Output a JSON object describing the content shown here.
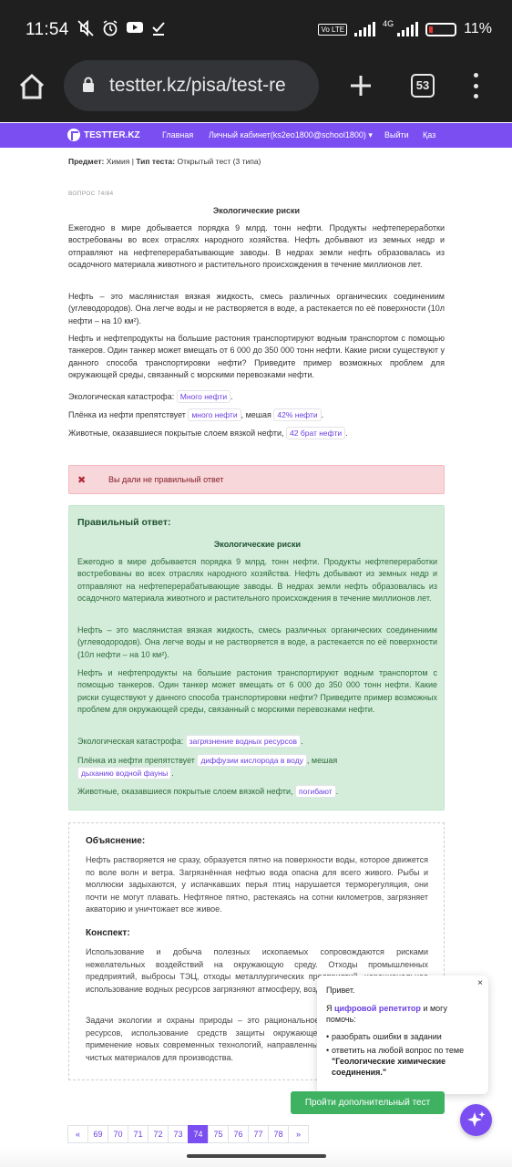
{
  "status_bar": {
    "time": "11:54",
    "network": "4G",
    "volte": "Vo LTE",
    "battery": "11%"
  },
  "browser": {
    "url": "testter.kz/pisa/test-re",
    "tab_count": "53"
  },
  "site_nav": {
    "logo": "TESTTER.KZ",
    "items": [
      "Главная",
      "Личный кабинет(ks2eo1800@school1800) ▾",
      "Выйти",
      "Қаз"
    ]
  },
  "meta": {
    "subject_label": "Предмет:",
    "subject": "Химия",
    "type_label": "Тип теста:",
    "type": "Открытый тест (3 типа)"
  },
  "question": {
    "number": "ВОПРОС 74/84",
    "title": "Экологические риски",
    "paragraphs": [
      "Ежегодно в мире добывается порядка 9 млрд. тонн нефти. Продукты нефтепереработки востребованы во всех отраслях народного хозяйства. Нефть добывают из земных недр и отправляют на нефтеперерабатывающие заводы. В недрах земли нефть образовалась из осадочного материала животного и растительного происхождения в течение миллионов лет.",
      "Нефть – это маслянистая вязкая жидкость, смесь различных органических соединениим (углеводородов). Она легче воды и не растворяется в воде, а растекается по её поверхности (10л нефти – на 10 км²).",
      "Нефть и нефтепродукты на большие растония транспортируют водным транспортом с помощью танкеров. Один танкер может вмещать от 6 000 до 350 000 тонн нефти. Какие риски существуют у данного способа транспортировки нефти? Приведите пример возможных проблем для окружающей среды, связанный с морскими перевозками нефти."
    ],
    "line1_label": "Экологическая катастрофа:",
    "line1_answer": "Много нефти",
    "line2_label": "Плёнка из нефти препятствует",
    "line2_answer1": "много нефти",
    "line2_mid": ", мешая",
    "line2_answer2": "42% нефти",
    "line3_label": "Животные, оказавшиеся покрытые слоем вязкой нефти,",
    "line3_answer": "42 брат нефти"
  },
  "alert": {
    "icon": "✖",
    "message": "Вы дали не правильный ответ"
  },
  "correct": {
    "heading": "Правильный ответ:",
    "title": "Экологические риски",
    "paragraphs": [
      "Ежегодно в мире добывается порядка 9 млрд. тонн нефти. Продукты нефтепереработки востребованы во всех отраслях народного хозяйства. Нефть добывают из земных недр и отправляют на нефтеперерабатывающие заводы. В недрах земли нефть образовалась из осадочного материала животного и растительного происхождения в течение миллионов лет.",
      "Нефть – это маслянистая вязкая жидкость, смесь различных органических соединениим (углеводородов). Она легче воды и не растворяется в воде, а растекается по её поверхности (10л нефти – на 10 км²).",
      "Нефть и нефтепродукты на большие растония транспортируют водным транспортом с помощью танкеров. Один танкер может вмещать от 6 000 до 350 000 тонн нефти. Какие риски существуют у данного способа транспортировки нефти? Приведите пример возможных проблем для окружающей среды, связанный с морскими перевозками нефти."
    ],
    "line1_label": "Экологическая катастрофа:",
    "line1_answer": "загрязнение водных ресурсов",
    "line2_label": "Плёнка из нефти препятствует",
    "line2_answer1": "диффузии кислорода в воду",
    "line2_mid": ", мешая",
    "line2_answer2": "дыханию водной фауны",
    "line3_label": "Животные, оказавшиеся покрытые слоем вязкой нефти,",
    "line3_answer": "погибают"
  },
  "explanation": {
    "heading": "Объяснение:",
    "text": "Нефть растворяется не сразу, образуется пятно на поверхности воды, которое движется по воле волн и ветра. Загрязнённая нефтью вода опасна для всего живого. Рыбы и моллюски задыхаются, у испачкавших перья птиц нарушается терморегуляция, они почти не могут плавать. Нефтяное пятно, растекаясь на сотни километров, загрязняет акваторию и уничтожает все живое.",
    "summary_heading": "Конспект:",
    "summary_1": "Использование и добыча полезных ископаемых сопровождаются рисками нежелательных воздействий на окружающую среду. Отходы промышленных предприятий, выбросы ТЭЦ, отходы металлургических предприятий, нерациональное использование водных ресурсов загрязняют атмосферу, воздуха, почвы и воды.",
    "summary_2": "Задачи экологии и охраны природы – это рациональное использование природных ресурсов, использование средств защиты окружающей среды от загрязнений, применение новых современных технологий, направленных на создание экологически чистых материалов для производства."
  },
  "chat": {
    "close": "×",
    "greeting": "Привет.",
    "intro_prefix": "Я ",
    "intro_link": "цифровой репетитор",
    "intro_suffix": " и могу помочь:",
    "bullet1": "разобрать ошибки в задании",
    "bullet2_prefix": "ответить на любой вопрос по теме ",
    "bullet2_topic": "\"Геологические химические соединения.\""
  },
  "more_tests_button": "Пройти дополнительный тест",
  "pagination": [
    "«",
    "69",
    "70",
    "71",
    "72",
    "73",
    "74",
    "75",
    "76",
    "77",
    "78",
    "»"
  ],
  "pagination_active": "74",
  "colors": {
    "accent": "#7b4ef2",
    "success_bg": "#d4edda",
    "error_bg": "#f8d7da",
    "button_green": "#3fb262"
  }
}
